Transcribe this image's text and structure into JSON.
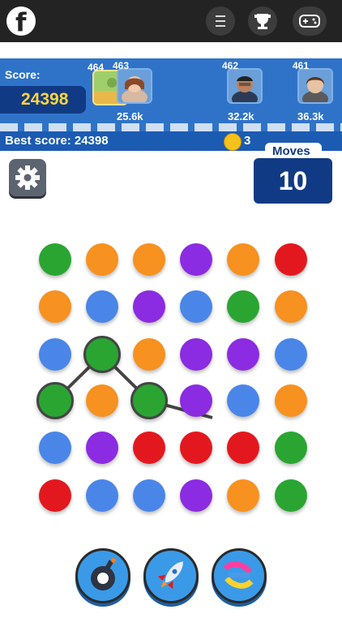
{
  "colors": {
    "green": "#2aa532",
    "orange": "#f7911f",
    "red": "#e3181f",
    "purple": "#8b2be2",
    "blue": "#4a86e8"
  },
  "top_bar": {
    "facebook_icon": "facebook-icon",
    "menu_icon": "menu-icon",
    "trophy_icon": "trophy-icon",
    "gamepad_icon": "gamepad-icon"
  },
  "header": {
    "score_label": "Score:",
    "score_value": "24398",
    "leaderboard": [
      {
        "rank": "464",
        "points": ""
      },
      {
        "rank": "463",
        "points": "25.6k"
      },
      {
        "rank": "462",
        "points": "32.2k"
      },
      {
        "rank": "461",
        "points": "36.3k"
      }
    ],
    "best_score": "Best score: 24398",
    "coins": "3"
  },
  "moves": {
    "label": "Moves",
    "value": "10"
  },
  "board": [
    [
      "green",
      "orange",
      "orange",
      "purple",
      "orange",
      "red"
    ],
    [
      "orange",
      "blue",
      "purple",
      "blue",
      "green",
      "orange"
    ],
    [
      "blue",
      "green",
      "orange",
      "purple",
      "purple",
      "blue"
    ],
    [
      "green",
      "orange",
      "green",
      "purple",
      "blue",
      "orange"
    ],
    [
      "blue",
      "purple",
      "red",
      "red",
      "red",
      "green"
    ],
    [
      "red",
      "blue",
      "blue",
      "purple",
      "orange",
      "green"
    ]
  ],
  "powerups": [
    "bomb-icon",
    "rocket-icon",
    "shuffle-icon"
  ]
}
